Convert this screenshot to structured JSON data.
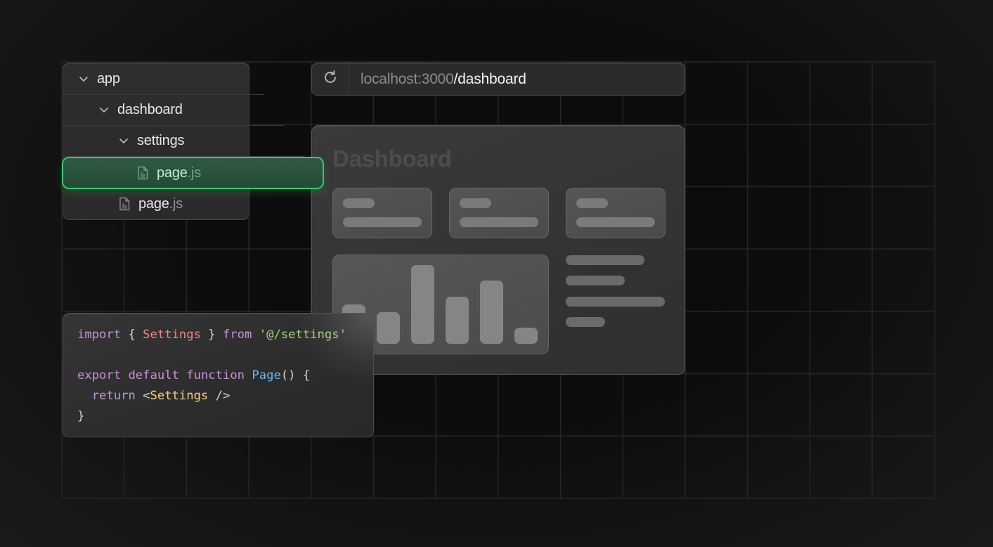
{
  "file_tree": {
    "items": [
      {
        "label": "app",
        "type": "folder",
        "expanded": true,
        "depth": 0
      },
      {
        "label": "dashboard",
        "type": "folder",
        "expanded": true,
        "depth": 1
      },
      {
        "label": "settings",
        "type": "folder",
        "expanded": true,
        "depth": 2
      },
      {
        "label_name": "page",
        "label_ext": ".js",
        "type": "file",
        "depth": 3,
        "selected": true
      },
      {
        "label_name": "page",
        "label_ext": ".js",
        "type": "file",
        "depth": 2,
        "selected": false
      }
    ],
    "selected_color": "#2ecc71",
    "icons": {
      "folder_toggle": "chevron-down-icon",
      "file": "file-icon"
    }
  },
  "browser": {
    "reload_icon": "reload-icon",
    "url_host": "localhost:3000",
    "url_path": "/dashboard"
  },
  "dashboard": {
    "title": "Dashboard",
    "stat_cards": 3,
    "bar_values": [
      56,
      45,
      112,
      67,
      90,
      23
    ],
    "list_lines": 4
  },
  "code": {
    "lines": [
      [
        {
          "t": "import",
          "c": "kw"
        },
        {
          "t": " { ",
          "c": "punc"
        },
        {
          "t": "Settings",
          "c": "name"
        },
        {
          "t": " } ",
          "c": "punc"
        },
        {
          "t": "from",
          "c": "kw"
        },
        {
          "t": " ",
          "c": "punc"
        },
        {
          "t": "'@/settings'",
          "c": "str"
        }
      ],
      [],
      [
        {
          "t": "export",
          "c": "kw"
        },
        {
          "t": " ",
          "c": "punc"
        },
        {
          "t": "default",
          "c": "kw"
        },
        {
          "t": " ",
          "c": "punc"
        },
        {
          "t": "function",
          "c": "kw"
        },
        {
          "t": " ",
          "c": "punc"
        },
        {
          "t": "Page",
          "c": "fn"
        },
        {
          "t": "() {",
          "c": "punc"
        }
      ],
      [
        {
          "t": "  ",
          "c": "punc"
        },
        {
          "t": "return",
          "c": "kw"
        },
        {
          "t": " <",
          "c": "punc"
        },
        {
          "t": "Settings",
          "c": "tag"
        },
        {
          "t": " />",
          "c": "punc"
        }
      ],
      [
        {
          "t": "}",
          "c": "punc"
        }
      ]
    ]
  }
}
